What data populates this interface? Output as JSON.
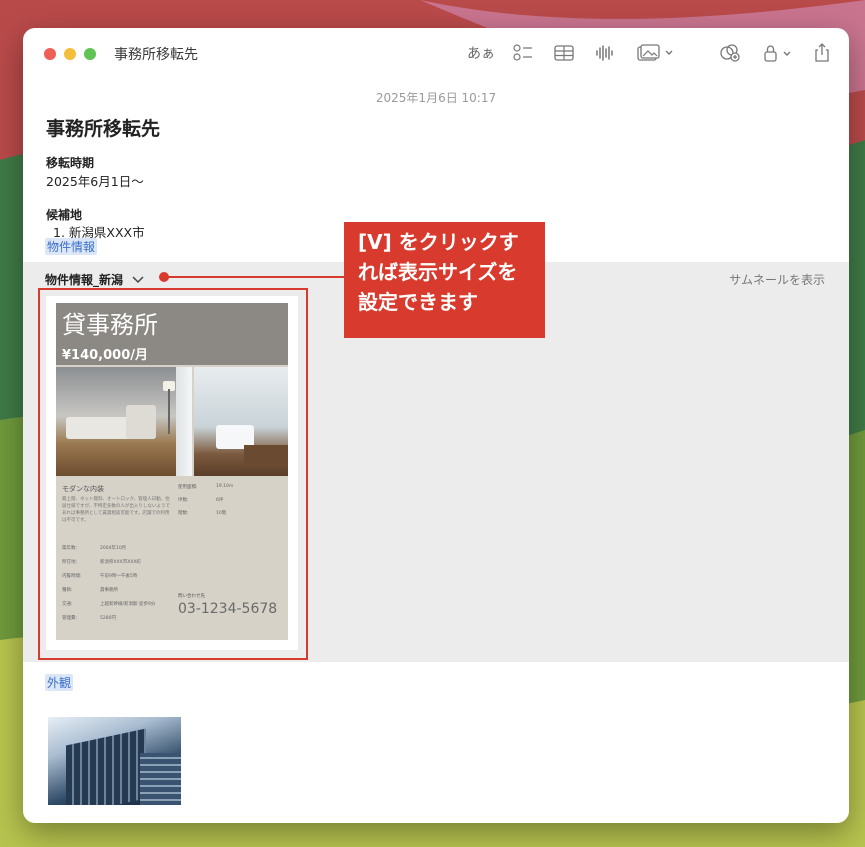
{
  "window": {
    "title": "事務所移転先",
    "toolbar": {
      "text_style_label": "あぁ",
      "icons": [
        "checklist-icon",
        "table-icon",
        "audio-icon",
        "media-icon",
        "collaborate-icon",
        "lock-icon",
        "share-icon"
      ]
    }
  },
  "note": {
    "date": "2025年1月6日 10:17",
    "title": "事務所移転先",
    "move_period_label": "移転時期",
    "move_period_value": "2025年6月1日〜",
    "candidates_label": "候補地",
    "candidate_1": "1. 新潟県XXX市",
    "property_tag": "物件情報",
    "exterior_tag": "外観"
  },
  "attachment": {
    "name": "物件情報_新潟",
    "thumbnail_toggle": "サムネールを表示"
  },
  "flyer": {
    "title": "貸事務所",
    "price": "¥140,000/月",
    "subheading": "モダンな内装",
    "description": "最上階、ネット無料、オートロック、管理人日勤。住居仕様ですが、不特定多数の人が出入りしないようであれば事務所として賃貸相談可能です。店舗での利用は不可です。",
    "specs_right": [
      {
        "label": "使用面積:",
        "value": "19.10m"
      },
      {
        "label": "坪数:",
        "value": "6坪"
      },
      {
        "label": "階数:",
        "value": "10階"
      }
    ],
    "specs_left": [
      {
        "label": "築年数:",
        "value": "2004年10月"
      },
      {
        "label": "所在地:",
        "value": "新潟県XXX市XXX町"
      },
      {
        "label": "内覧時間:",
        "value": "午前9時〜午後5時"
      },
      {
        "label": "種目:",
        "value": "貸事務所"
      },
      {
        "label": "交通:",
        "value": "上越新幹線/新潟駅 徒歩9分"
      },
      {
        "label": "管理費:",
        "value": "5280円"
      }
    ],
    "contact_label": "問い合わせ先",
    "phone": "03-1234-5678"
  },
  "callout": {
    "text": "[V] をクリックすれば表示サイズを設定できます",
    "line1": "[V] をクリックす",
    "line2": "れば表示サイズを",
    "line3": "設定できます",
    "color": "#d93a2e"
  }
}
